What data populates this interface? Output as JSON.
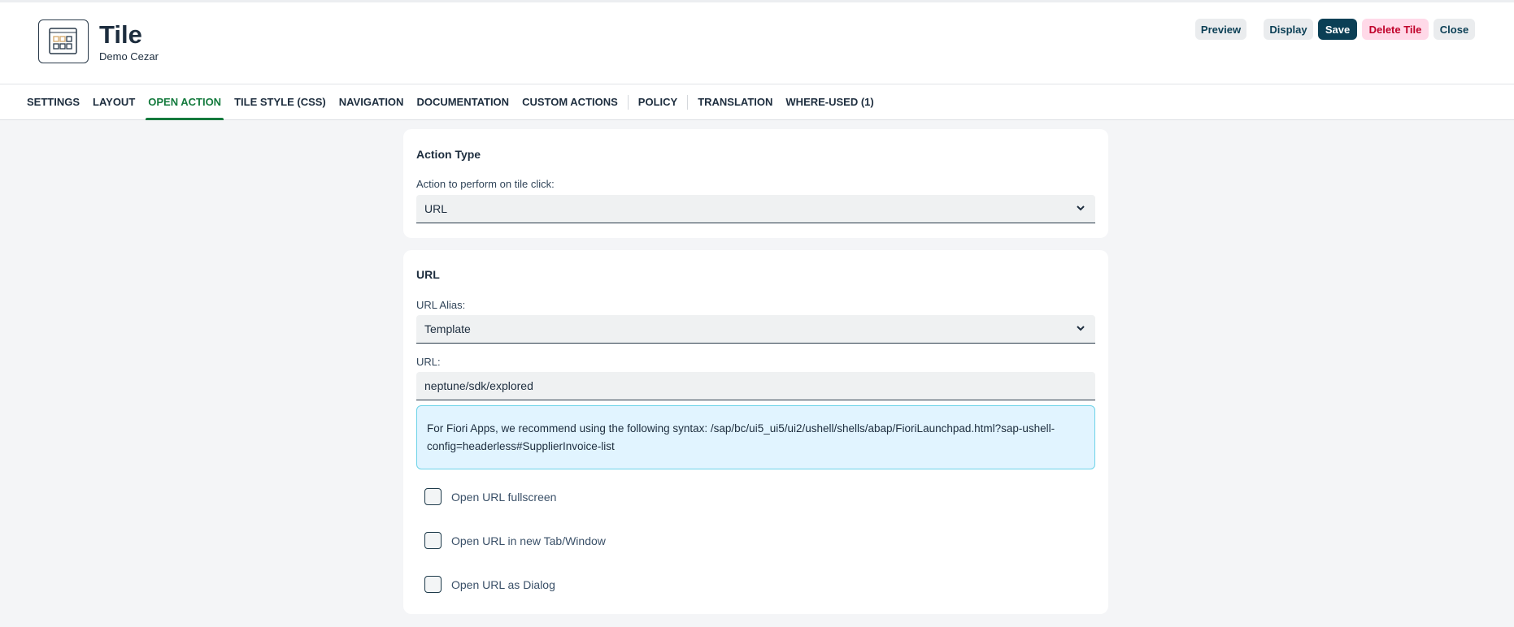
{
  "header": {
    "title": "Tile",
    "subtitle": "Demo Cezar"
  },
  "toolbar": {
    "preview": "Preview",
    "display": "Display",
    "save": "Save",
    "delete": "Delete Tile",
    "close": "Close"
  },
  "tabs": [
    "SETTINGS",
    "LAYOUT",
    "OPEN ACTION",
    "TILE STYLE (CSS)",
    "NAVIGATION",
    "DOCUMENTATION",
    "CUSTOM ACTIONS",
    "POLICY",
    "TRANSLATION",
    "WHERE-USED (1)"
  ],
  "action_type": {
    "title": "Action Type",
    "label": "Action to perform on tile click:",
    "value": "URL"
  },
  "url_section": {
    "title": "URL",
    "alias_label": "URL Alias:",
    "alias_value": "Template",
    "url_label": "URL:",
    "url_value": "neptune/sdk/explored",
    "info": "For Fiori Apps, we recommend using the following syntax: /sap/bc/ui5_ui5/ui2/ushell/shells/abap/FioriLaunchpad.html?sap-ushell-config=headerless#SupplierInvoice-list",
    "checkboxes": [
      "Open URL fullscreen",
      "Open URL in new Tab/Window",
      "Open URL as Dialog"
    ]
  },
  "colors": {
    "accent": "#147a3d",
    "save": "#0b3f55",
    "delete_bg": "#ffd9e8",
    "delete_text": "#c0002a"
  }
}
